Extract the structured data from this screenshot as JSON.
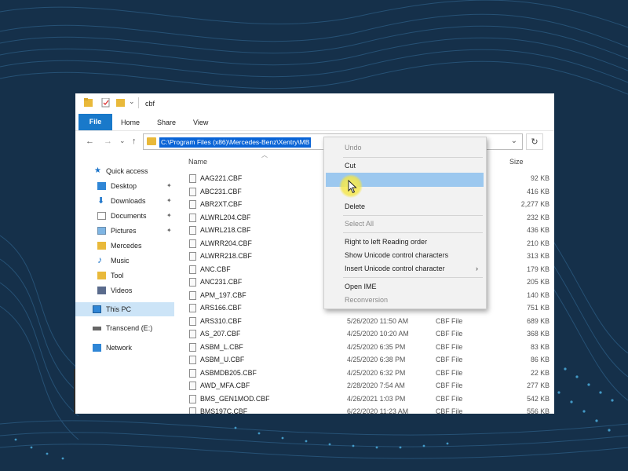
{
  "window": {
    "title": "cbf",
    "ribbon_tabs": [
      "File",
      "Home",
      "Share",
      "View"
    ],
    "address_path": "C:\\Program Files (x86)\\Mercedes-Benz\\Xentry\\MB",
    "refresh_icon": "↻",
    "nav_back": "←",
    "nav_forward": "→",
    "nav_recent": "⌄",
    "nav_up": "↑",
    "addr_dropdown": "⌄"
  },
  "nav_pane": {
    "quick_access": "Quick access",
    "items": [
      {
        "label": "Desktop",
        "icon": "desktop-icon",
        "pinned": true
      },
      {
        "label": "Downloads",
        "icon": "download-icon",
        "pinned": true
      },
      {
        "label": "Documents",
        "icon": "documents-icon",
        "pinned": true
      },
      {
        "label": "Pictures",
        "icon": "pictures-icon",
        "pinned": true
      },
      {
        "label": "Mercedes",
        "icon": "folder-icon",
        "pinned": false
      },
      {
        "label": "Music",
        "icon": "music-icon",
        "pinned": false
      },
      {
        "label": "Tool",
        "icon": "folder-icon",
        "pinned": false
      },
      {
        "label": "Videos",
        "icon": "videos-icon",
        "pinned": false
      }
    ],
    "this_pc": "This PC",
    "drive": "Transcend (E:)",
    "network": "Network",
    "pin_glyph": "📌"
  },
  "columns": {
    "name": "Name",
    "size": "Size"
  },
  "files": [
    {
      "name": "AAG221.CBF",
      "date": "",
      "type": "",
      "size": "92 KB"
    },
    {
      "name": "ABC231.CBF",
      "date": "",
      "type": "",
      "size": "416 KB"
    },
    {
      "name": "ABR2XT.CBF",
      "date": "",
      "type": "",
      "size": "2,277 KB"
    },
    {
      "name": "ALWRL204.CBF",
      "date": "",
      "type": "",
      "size": "232 KB"
    },
    {
      "name": "ALWRL218.CBF",
      "date": "",
      "type": "",
      "size": "436 KB"
    },
    {
      "name": "ALWRR204.CBF",
      "date": "",
      "type": "",
      "size": "210 KB"
    },
    {
      "name": "ALWRR218.CBF",
      "date": "",
      "type": "",
      "size": "313 KB"
    },
    {
      "name": "ANC.CBF",
      "date": "",
      "type": "",
      "size": "179 KB"
    },
    {
      "name": "ANC231.CBF",
      "date": "",
      "type": "",
      "size": "205 KB"
    },
    {
      "name": "APM_197.CBF",
      "date": "",
      "type": "",
      "size": "140 KB"
    },
    {
      "name": "ARS166.CBF",
      "date": "",
      "type": "",
      "size": "751 KB"
    },
    {
      "name": "ARS310.CBF",
      "date": "5/26/2020 11:50 AM",
      "type": "CBF File",
      "size": "689 KB"
    },
    {
      "name": "AS_207.CBF",
      "date": "4/25/2020 10:20 AM",
      "type": "CBF File",
      "size": "368 KB"
    },
    {
      "name": "ASBM_L.CBF",
      "date": "4/25/2020 6:35 PM",
      "type": "CBF File",
      "size": "83 KB"
    },
    {
      "name": "ASBM_U.CBF",
      "date": "4/25/2020 6:38 PM",
      "type": "CBF File",
      "size": "86 KB"
    },
    {
      "name": "ASBMDB205.CBF",
      "date": "4/25/2020 6:32 PM",
      "type": "CBF File",
      "size": "22 KB"
    },
    {
      "name": "AWD_MFA.CBF",
      "date": "2/28/2020 7:54 AM",
      "type": "CBF File",
      "size": "277 KB"
    },
    {
      "name": "BMS_GEN1MOD.CBF",
      "date": "4/26/2021 1:03 PM",
      "type": "CBF File",
      "size": "542 KB"
    },
    {
      "name": "BMS197C.CBF",
      "date": "6/22/2020 11:23 AM",
      "type": "CBF File",
      "size": "556 KB"
    }
  ],
  "context_menu": {
    "undo": "Undo",
    "cut": "Cut",
    "delete": "Delete",
    "select_all": "Select All",
    "rtl": "Right to left Reading order",
    "show_unicode": "Show Unicode control characters",
    "insert_unicode": "Insert Unicode control character",
    "submenu_arrow": "›",
    "open_ime": "Open IME",
    "reconversion": "Reconversion"
  }
}
